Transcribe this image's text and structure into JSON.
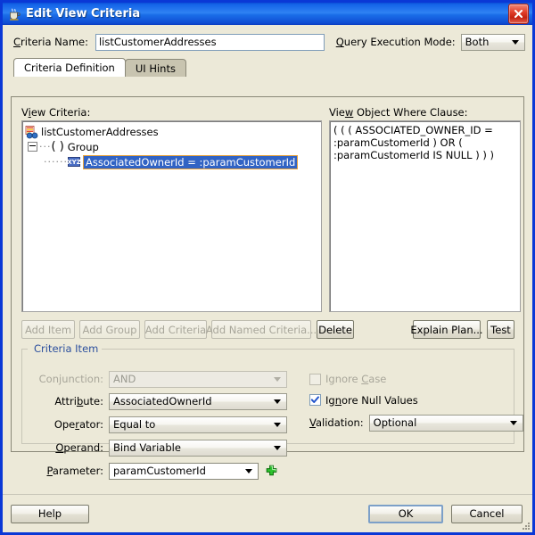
{
  "window": {
    "title": "Edit View Criteria",
    "app_icon": "java-coffee-cup-icon",
    "close_label": "×"
  },
  "form": {
    "criteria_name_label": "Criteria Name:",
    "criteria_name_value": "listCustomerAddresses",
    "query_execution_mode_label": "Query Execution Mode:",
    "query_execution_mode_value": "Both"
  },
  "tabs": [
    {
      "label": "Criteria Definition",
      "active": true
    },
    {
      "label": "UI Hints",
      "active": false
    }
  ],
  "view_criteria": {
    "label": "View Criteria:",
    "root": "listCustomerAddresses",
    "group": "Group",
    "group_paren": "( )",
    "item": "AssociatedOwnerId = :paramCustomerId"
  },
  "where_clause": {
    "label": "View Object Where Clause:",
    "text": "( ( ( ASSOCIATED_OWNER_ID =\n:paramCustomerId  )  OR  (\n:paramCustomerId IS NULL ) ) )"
  },
  "toolbar": {
    "add_item": "Add Item",
    "add_group": "Add Group",
    "add_criteria": "Add Criteria",
    "add_named_criteria": "Add Named Criteria...",
    "delete": "Delete",
    "explain_plan": "Explain Plan...",
    "test": "Test"
  },
  "criteria_item": {
    "title": "Criteria Item",
    "conjunction_label": "Conjunction:",
    "conjunction_value": "AND",
    "attribute_label": "Attribute:",
    "attribute_value": "AssociatedOwnerId",
    "operator_label": "Operator:",
    "operator_value": "Equal to",
    "operand_label": "Operand:",
    "operand_value": "Bind Variable",
    "parameter_label": "Parameter:",
    "parameter_value": "paramCustomerId",
    "add_parameter_icon": "green-plus-icon",
    "ignore_case_label": "Ignore Case",
    "ignore_case_checked": false,
    "ignore_null_label": "Ignore Null Values",
    "ignore_null_checked": true,
    "validation_label": "Validation:",
    "validation_value": "Optional"
  },
  "footer": {
    "help": "Help",
    "ok": "OK",
    "cancel": "Cancel"
  },
  "colors": {
    "titlebar_blue": "#1464e8",
    "window_border": "#0a38d6",
    "dialog_bg": "#ece9d8",
    "selection_blue": "#3163c4",
    "selection_border": "#e8a33d",
    "group_title": "#2b4f9e",
    "close_red": "#c52210",
    "plus_green": "#22b022"
  }
}
